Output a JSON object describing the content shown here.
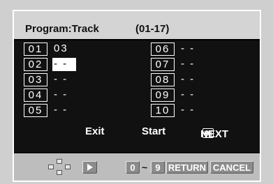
{
  "header": {
    "title": "Program:Track",
    "range": "(01-17)"
  },
  "left_rows": [
    {
      "num": "01",
      "value": "03"
    },
    {
      "num": "02",
      "value": "- -"
    },
    {
      "num": "03",
      "value": "- -"
    },
    {
      "num": "04",
      "value": "- -"
    },
    {
      "num": "05",
      "value": "- -"
    }
  ],
  "right_rows": [
    {
      "num": "06",
      "value": "- -"
    },
    {
      "num": "07",
      "value": "- -"
    },
    {
      "num": "08",
      "value": "- -"
    },
    {
      "num": "09",
      "value": "- -"
    },
    {
      "num": "10",
      "value": "- -"
    }
  ],
  "actions": {
    "exit": "Exit",
    "start": "Start",
    "next": "NEXT"
  },
  "footer": {
    "zero": "0",
    "tilde": "~",
    "nine": "9",
    "return": "RETURN",
    "cancel": "CANCEL"
  },
  "icons": {
    "navigation": "dpad-icon",
    "play": "play-icon",
    "next": "skip-next-icon"
  },
  "colors": {
    "screen_bg": "#111111",
    "header_bg": "#d4d4d4",
    "footer_bg": "#bdbdbd",
    "key_bg": "#8c8c8c"
  }
}
